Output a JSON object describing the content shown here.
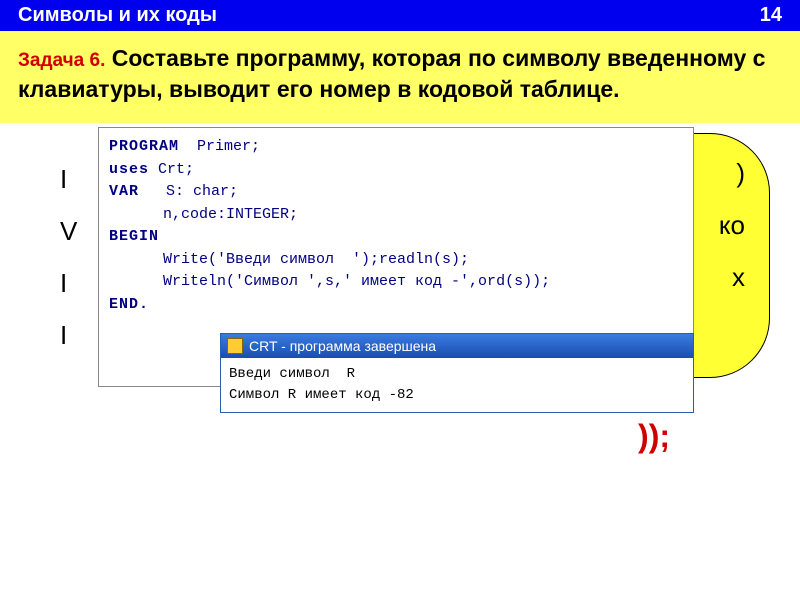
{
  "header": {
    "title": "Символы и их коды",
    "page_number": "14"
  },
  "task": {
    "label": "Задача 6.",
    "text": "Составьте программу, которая по символу введенному с клавиатуры, выводит его номер в кодовой таблице."
  },
  "background": {
    "frag1": ")",
    "frag2": "ко",
    "frag3": "х",
    "paren": "));",
    "left1": "I",
    "left2": "V",
    "left3": "I",
    "left4": "I"
  },
  "code": {
    "l1_kw": "PROGRAM",
    "l1_rest": "  Primer;",
    "l2_kw": "uses",
    "l2_rest": " Crt;",
    "l3_kw": "VAR",
    "l3_rest": "   S: char;",
    "l4": "      n,code:INTEGER;",
    "l5_kw": "BEGIN",
    "l6": "      Write('Введи символ  ');readln(s);",
    "l7": "      Writeln('Символ ',s,' имеет код -',ord(s));",
    "l8_kw": "END."
  },
  "console": {
    "title": "CRT - программа завершена",
    "line1": "Введи символ  R",
    "line2": "Символ R имеет код -82"
  }
}
